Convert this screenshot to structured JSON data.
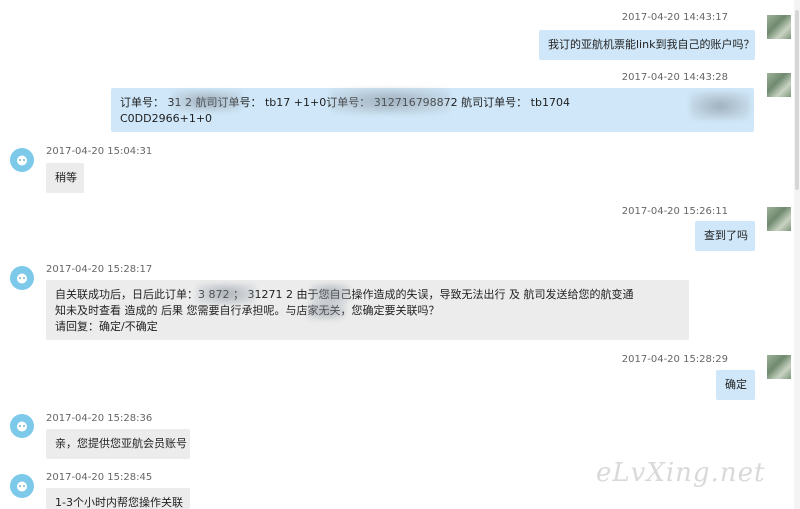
{
  "conversation": {
    "messages": [
      {
        "id": "m1",
        "sender": "user",
        "timestamp": "2017-04-20 14:43:17",
        "lines": [
          "我订的亚航机票能link到我自己的账户吗？"
        ]
      },
      {
        "id": "m2",
        "sender": "user",
        "timestamp": "2017-04-20 14:43:28",
        "lines": [
          "订单号： 31          2  航司订单号： tb17                     +1+0订单号：  312716798872  航司订单号：  tb1704",
          "C0DD2966+1+0"
        ]
      },
      {
        "id": "m3",
        "sender": "agent",
        "timestamp": "2017-04-20 15:04:31",
        "lines": [
          "稍等"
        ]
      },
      {
        "id": "m4",
        "sender": "user",
        "timestamp": "2017-04-20 15:26:11",
        "lines": [
          "查到了吗"
        ]
      },
      {
        "id": "m5",
        "sender": "agent",
        "timestamp": "2017-04-20 15:28:17",
        "lines": [
          "自关联成功后，日后此订单：3          872  ；  31271         2 由于您自己操作造成的失误，导致无法出行 及 航司发送给您的航变通",
          "知未及时查看 造成的 后果 您需要自行承担呢。与店家无关，您确定要关联吗？",
          "请回复：确定/不确定"
        ]
      },
      {
        "id": "m6",
        "sender": "user",
        "timestamp": "2017-04-20 15:28:29",
        "lines": [
          "确定"
        ]
      },
      {
        "id": "m7",
        "sender": "agent",
        "timestamp": "2017-04-20 15:28:36",
        "lines": [
          "亲，您提供您亚航会员账号"
        ]
      },
      {
        "id": "m8",
        "sender": "agent",
        "timestamp": "2017-04-20 15:28:45",
        "lines": [
          "1-3个小时内帮您操作关联"
        ]
      }
    ]
  },
  "watermark": "eLvXing.net",
  "colors": {
    "outgoing_bubble": "#cfe7f8",
    "incoming_bubble": "#ececec",
    "agent_avatar": "#7cc9ea"
  },
  "icons": {
    "agent_avatar": "cat-face-avatar-icon",
    "user_avatar": "photo-avatar"
  }
}
